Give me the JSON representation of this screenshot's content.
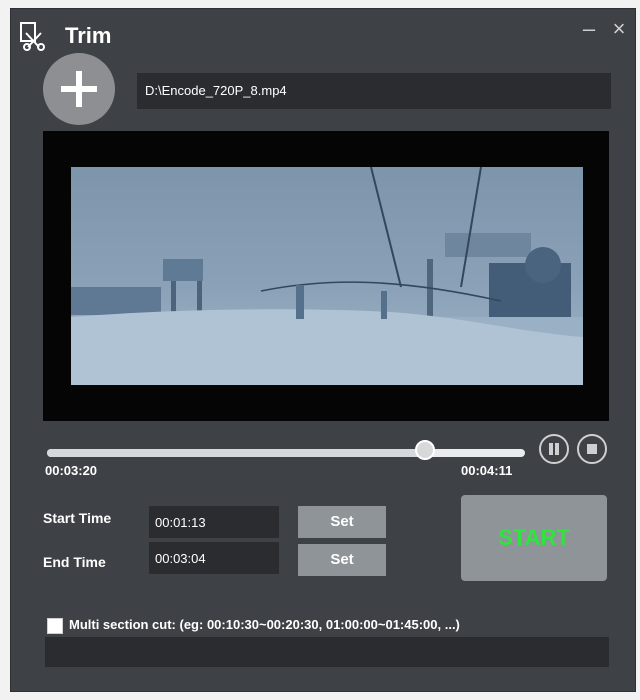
{
  "window": {
    "title": "Trim",
    "minimize_icon": "minimize-icon",
    "close_icon": "close-icon"
  },
  "file": {
    "path": "D:\\Encode_720P_8.mp4",
    "add_icon": "plus-icon"
  },
  "player": {
    "current_time": "00:03:20",
    "duration": "00:04:11",
    "progress": 0.797,
    "pause_icon": "pause-icon",
    "stop_icon": "stop-icon"
  },
  "trim": {
    "start_label": "Start Time",
    "start_value": "00:01:13",
    "end_label": "End Time",
    "end_value": "00:03:04",
    "set_label": "Set",
    "start_button_label": "START"
  },
  "multi_section": {
    "label": "Multi section cut: (eg: 00:10:30~00:20:30, 01:00:00~01:45:00, ...)",
    "value": ""
  },
  "colors": {
    "window_bg": "#3e4145",
    "start_text": "#2fe53d"
  }
}
